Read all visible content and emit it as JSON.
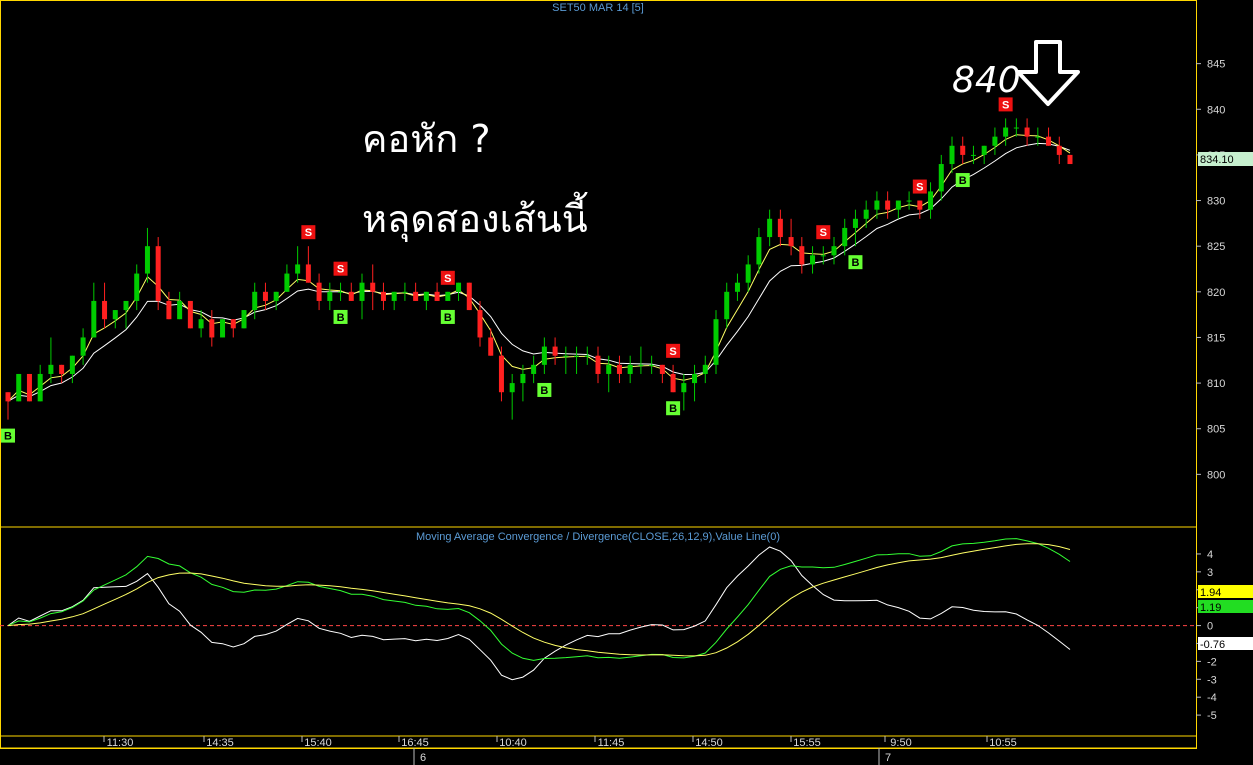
{
  "chart_data": [
    {
      "type": "candlestick",
      "title": "SET50 MAR 14   [5]",
      "ylim": [
        795,
        850
      ],
      "y_ticks": [
        800,
        805,
        810,
        815,
        820,
        825,
        830,
        835,
        840,
        845
      ],
      "last_price": "834.10",
      "series_note": "price with two moving averages",
      "candles": [
        [
          809,
          809,
          806,
          808
        ],
        [
          808,
          811,
          808,
          811
        ],
        [
          811,
          811,
          808,
          808
        ],
        [
          808,
          812,
          808,
          811
        ],
        [
          811,
          815,
          810,
          812
        ],
        [
          812,
          812,
          810,
          811
        ],
        [
          811,
          813,
          810,
          813
        ],
        [
          813,
          816,
          812,
          815
        ],
        [
          815,
          821,
          815,
          819
        ],
        [
          819,
          821,
          816,
          817
        ],
        [
          817,
          818,
          816,
          818
        ],
        [
          818,
          819,
          816,
          819
        ],
        [
          819,
          823,
          818,
          822
        ],
        [
          822,
          827,
          821,
          825
        ],
        [
          825,
          826,
          818,
          819
        ],
        [
          819,
          820,
          817,
          817
        ],
        [
          817,
          820,
          817,
          819
        ],
        [
          819,
          819,
          816,
          816
        ],
        [
          816,
          818,
          815,
          817
        ],
        [
          817,
          818,
          814,
          815
        ],
        [
          815,
          817,
          815,
          817
        ],
        [
          817,
          817,
          815,
          816
        ],
        [
          816,
          818,
          816,
          818
        ],
        [
          818,
          821,
          817,
          820
        ],
        [
          820,
          821,
          818,
          819
        ],
        [
          819,
          820,
          818,
          820
        ],
        [
          820,
          823,
          820,
          822
        ],
        [
          822,
          825,
          821,
          823
        ],
        [
          823,
          825,
          821,
          821
        ],
        [
          821,
          822,
          818,
          819
        ],
        [
          819,
          821,
          818,
          820
        ],
        [
          820,
          821,
          819,
          820
        ],
        [
          820,
          821,
          819,
          819
        ],
        [
          819,
          822,
          817,
          821
        ],
        [
          821,
          823,
          818,
          820
        ],
        [
          820,
          821,
          818,
          819
        ],
        [
          819,
          820,
          818,
          820
        ],
        [
          820,
          821,
          819,
          820
        ],
        [
          820,
          821,
          819,
          819
        ],
        [
          819,
          820,
          818,
          820
        ],
        [
          820,
          821,
          819,
          819
        ],
        [
          819,
          820,
          819,
          820
        ],
        [
          820,
          821,
          819,
          821
        ],
        [
          821,
          821,
          818,
          818
        ],
        [
          818,
          819,
          814,
          815
        ],
        [
          815,
          816,
          813,
          813
        ],
        [
          813,
          814,
          808,
          809
        ],
        [
          809,
          811,
          806,
          810
        ],
        [
          810,
          812,
          808,
          811
        ],
        [
          811,
          813,
          810,
          812
        ],
        [
          812,
          815,
          811,
          814
        ],
        [
          814,
          815,
          812,
          813
        ],
        [
          813,
          814,
          811,
          813
        ],
        [
          813,
          814,
          811,
          813
        ],
        [
          813,
          814,
          812,
          813
        ],
        [
          813,
          814,
          810,
          811
        ],
        [
          811,
          813,
          809,
          812
        ],
        [
          812,
          813,
          810,
          811
        ],
        [
          811,
          813,
          810,
          812
        ],
        [
          812,
          814,
          811,
          812
        ],
        [
          812,
          813,
          811,
          812
        ],
        [
          812,
          812,
          810,
          811
        ],
        [
          811,
          812,
          809,
          809
        ],
        [
          809,
          811,
          807,
          810
        ],
        [
          810,
          812,
          808,
          811
        ],
        [
          811,
          813,
          810,
          812
        ],
        [
          812,
          818,
          811,
          817
        ],
        [
          817,
          821,
          816,
          820
        ],
        [
          820,
          822,
          819,
          821
        ],
        [
          821,
          824,
          820,
          823
        ],
        [
          823,
          827,
          822,
          826
        ],
        [
          826,
          829,
          825,
          828
        ],
        [
          828,
          829,
          825,
          826
        ],
        [
          826,
          828,
          824,
          825
        ],
        [
          825,
          826,
          822,
          823
        ],
        [
          823,
          825,
          822,
          824
        ],
        [
          824,
          825,
          823,
          824
        ],
        [
          824,
          826,
          823,
          825
        ],
        [
          825,
          828,
          824,
          827
        ],
        [
          827,
          829,
          825,
          828
        ],
        [
          828,
          830,
          827,
          829
        ],
        [
          829,
          831,
          828,
          830
        ],
        [
          830,
          831,
          828,
          829
        ],
        [
          829,
          830,
          828,
          830
        ],
        [
          830,
          831,
          829,
          830
        ],
        [
          830,
          830,
          828,
          829
        ],
        [
          829,
          832,
          828,
          831
        ],
        [
          831,
          835,
          830,
          834
        ],
        [
          834,
          837,
          833,
          836
        ],
        [
          836,
          837,
          834,
          835
        ],
        [
          835,
          836,
          834,
          835
        ],
        [
          835,
          836,
          834,
          836
        ],
        [
          836,
          838,
          835,
          837
        ],
        [
          837,
          839,
          836,
          838
        ],
        [
          838,
          839,
          837,
          838
        ],
        [
          838,
          839,
          836,
          837
        ],
        [
          837,
          838,
          836,
          837
        ],
        [
          837,
          838,
          836,
          836
        ],
        [
          836,
          837,
          834,
          835
        ],
        [
          835,
          835,
          834,
          834
        ]
      ],
      "buy_signals": [
        0,
        31,
        41,
        50,
        62,
        79,
        89
      ],
      "sell_signals": [
        28,
        31,
        41,
        62,
        76,
        85,
        93
      ],
      "annotations": {
        "text1": "คอหัก ?",
        "text2": "หลุดสองเส้นนี้",
        "peak_label": "840"
      },
      "x_labels": [
        "11:30",
        "14:35",
        "15:40",
        "16:45",
        "10:40",
        "11:45",
        "14:50",
        "15:55",
        "9:50",
        "10:55"
      ],
      "date_labels": [
        "6",
        "7"
      ],
      "signal_labels": {
        "buy": "B",
        "sell": "S"
      }
    },
    {
      "type": "line",
      "title": "Moving Average Convergence / Divergence(CLOSE,26,12,9),Value Line(0)",
      "ylim": [
        -6,
        4.5
      ],
      "y_ticks": [
        4,
        3,
        2,
        1,
        0,
        -1,
        -2,
        -3,
        -4,
        -5
      ],
      "value_labels": [
        "1.94",
        "1.19",
        "-0.76"
      ],
      "colors": {
        "macd": "#33ff33",
        "signal": "#ffff66",
        "histogram": "#ffffff",
        "zero": "#ff4444"
      }
    }
  ],
  "colors": {
    "up": "#00cc00",
    "down": "#ff2020",
    "ma_fast": "#ffff66",
    "ma_slow": "#ffffff",
    "border": "#ffd700",
    "text": "#d8d8d8",
    "title": "#5b9bd5"
  }
}
